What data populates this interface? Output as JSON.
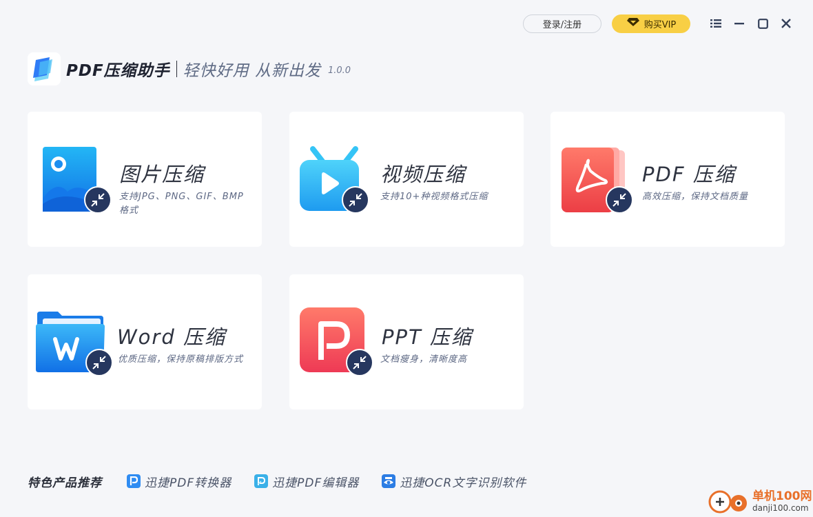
{
  "topbar": {
    "login_label": "登录/注册",
    "vip_label": "购买VIP",
    "menu_icon": "list-menu-icon",
    "minimize_icon": "minimize-icon",
    "maximize_icon": "maximize-icon",
    "close_icon": "close-icon"
  },
  "header": {
    "app_name": "PDF压缩助手",
    "slogan": "轻快好用 从新出发",
    "version": "1.0.0"
  },
  "cards": [
    {
      "title": "图片压缩",
      "desc": "支持JPG、PNG、GIF、BMP格式",
      "icon": "image-icon",
      "color": "#1c8ef0"
    },
    {
      "title": "视频压缩",
      "desc": "支持10+种视频格式压缩",
      "icon": "video-tv-icon",
      "color": "#25b3f0"
    },
    {
      "title": "PDF 压缩",
      "desc": "高效压缩，保持文档质量",
      "icon": "pdf-acrobat-icon",
      "color": "#f25b52"
    },
    {
      "title": "Word 压缩",
      "desc": "优质压缩，保持原稿排版方式",
      "icon": "word-folder-icon",
      "color": "#1a86f0"
    },
    {
      "title": "PPT 压缩",
      "desc": "文档瘦身，清晰度高",
      "icon": "ppt-icon",
      "color": "#f2485a"
    }
  ],
  "footer": {
    "label": "特色产品推荐",
    "links": [
      {
        "text": "迅捷PDF转换器",
        "icon": "pdf-converter-icon",
        "color": "#2f8cf2"
      },
      {
        "text": "迅捷PDF编辑器",
        "icon": "pdf-editor-icon",
        "color": "#3ab0e8"
      },
      {
        "text": "迅捷OCR文字识别软件",
        "icon": "ocr-eye-icon",
        "color": "#2c7de4"
      }
    ]
  },
  "watermark": {
    "brand": "单机100网",
    "domain": "danji100.com"
  }
}
